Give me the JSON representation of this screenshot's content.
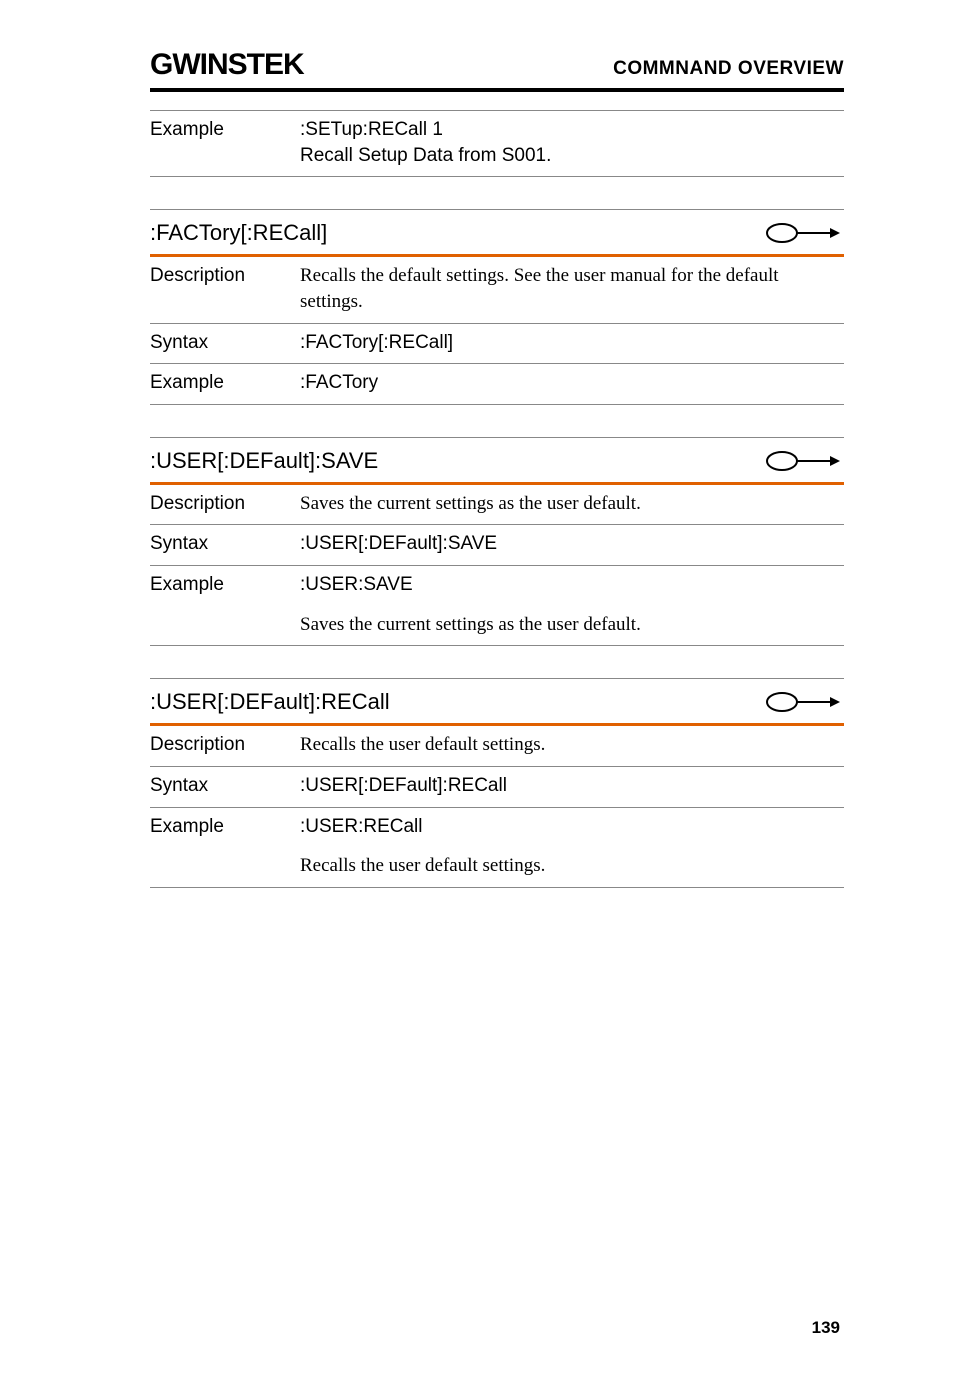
{
  "header": {
    "logo": "GWINSTEK",
    "right": "COMMNAND OVERVIEW"
  },
  "top_example": {
    "label": "Example",
    "line1": ":SETup:RECall 1",
    "line2": "Recall Setup Data from S001."
  },
  "sections": [
    {
      "title": ":FACTory[:RECall]",
      "rows": [
        {
          "label": "Description",
          "value": "Recalls the default settings. See the user manual for the default settings.",
          "serif": true
        },
        {
          "label": "Syntax",
          "value": ":FACTory[:RECall]"
        },
        {
          "label": "Example",
          "value": ":FACTory"
        }
      ]
    },
    {
      "title": ":USER[:DEFault]:SAVE",
      "rows": [
        {
          "label": "Description",
          "value": "Saves the current settings as the user default.",
          "serif": true
        },
        {
          "label": "Syntax",
          "value": ":USER[:DEFault]:SAVE"
        },
        {
          "label": "Example",
          "value": ":USER:SAVE",
          "extra": "Saves the current settings as the user default.",
          "noborder_first": true
        }
      ]
    },
    {
      "title": ":USER[:DEFault]:RECall",
      "rows": [
        {
          "label": "Description",
          "value": "Recalls the user default settings.",
          "serif": true
        },
        {
          "label": "Syntax",
          "value": ":USER[:DEFault]:RECall"
        },
        {
          "label": "Example",
          "value": ":USER:RECall",
          "extra": "Recalls the user default settings.",
          "noborder_first": true
        }
      ]
    }
  ],
  "page_number": "139"
}
